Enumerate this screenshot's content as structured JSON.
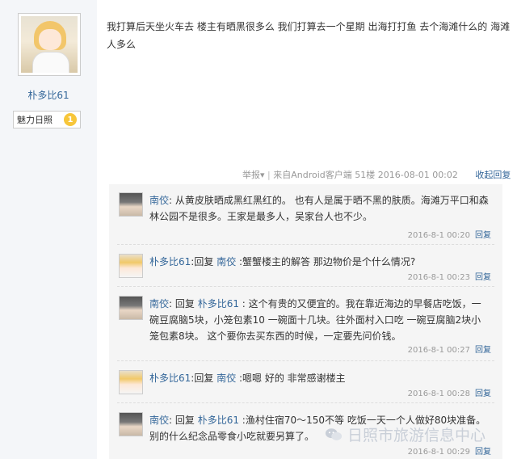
{
  "author": {
    "username": "朴多比61",
    "rank_label": "魅力日照",
    "rank_badge": "1"
  },
  "post": {
    "text": "我打算后天坐火车去 楼主有晒黑很多么 我们打算去一个星期 出海打打鱼 去个海滩什么的 海滩人多么"
  },
  "meta": {
    "report": "举报",
    "client": "来自Android客户端",
    "floor": "51楼",
    "timestamp": "2016-08-01 00:02",
    "collapse_reply": "收起回复"
  },
  "replies": [
    {
      "author": "南佼",
      "segments": [
        {
          "text": "南佼",
          "name": true
        },
        {
          "text": ": 从黄皮肤晒成黑红黑红的。 也有人是属于晒不黑的肤质。海滩万平口和森林公园不是很多。王家是最多人，吴家台人也不少。",
          "name": false
        }
      ],
      "time": "2016-8-1 00:20",
      "reply_label": "回复"
    },
    {
      "author": "朴多比61",
      "segments": [
        {
          "text": "朴多比61",
          "name": true
        },
        {
          "text": ":回复 ",
          "name": false
        },
        {
          "text": "南佼",
          "name": true
        },
        {
          "text": " :蟹蟹楼主的解答 那边物价是个什么情况?",
          "name": false
        }
      ],
      "time": "2016-8-1 00:23",
      "reply_label": "回复"
    },
    {
      "author": "南佼",
      "segments": [
        {
          "text": "南佼",
          "name": true
        },
        {
          "text": ": 回复 ",
          "name": false
        },
        {
          "text": "朴多比61",
          "name": true
        },
        {
          "text": " : 这个有贵的又便宜的。我在靠近海边的早餐店吃饭，一碗豆腐脑5块，小笼包素10 一碗面十几块。往外面村入口吃 一碗豆腐脑2块小笼包素8块。 这个要你去买东西的时候，一定要先问价钱。",
          "name": false
        }
      ],
      "time": "2016-8-1 00:27",
      "reply_label": "回复"
    },
    {
      "author": "朴多比61",
      "segments": [
        {
          "text": "朴多比61",
          "name": true
        },
        {
          "text": ":回复 ",
          "name": false
        },
        {
          "text": "南佼",
          "name": true
        },
        {
          "text": " :嗯嗯 好的 非常感谢楼主",
          "name": false
        }
      ],
      "time": "2016-8-1 00:28",
      "reply_label": "回复"
    },
    {
      "author": "南佼",
      "segments": [
        {
          "text": "南佼",
          "name": true
        },
        {
          "text": ": 回复 ",
          "name": false
        },
        {
          "text": "朴多比61",
          "name": true
        },
        {
          "text": " :渔村住宿70～150不等 吃饭一天一个人做好80块准备。别的什么纪念品零食小吃就要另算了。",
          "name": false
        }
      ],
      "time": "2016-8-1 00:29",
      "reply_label": "回复"
    }
  ],
  "watermark": "日照市旅游信息中心"
}
